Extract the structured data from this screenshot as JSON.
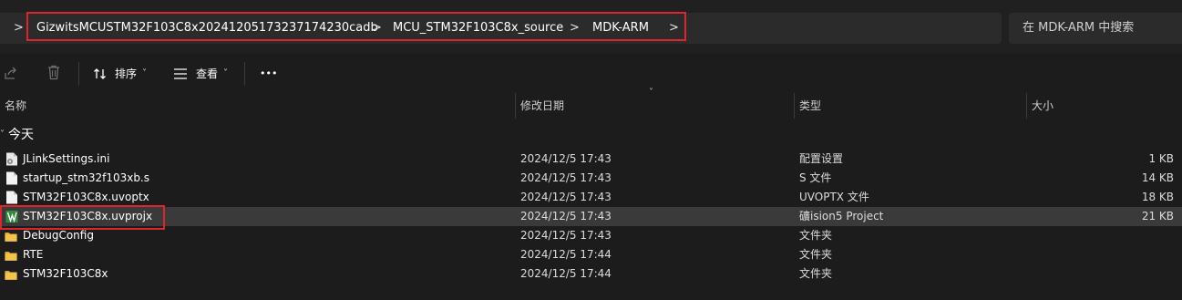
{
  "address_bar": {
    "crumbs": [
      "GizwitsMCUSTM32F103C8x20241205173237174230cadb",
      "MCU_STM32F103C8x_source",
      "MDK-ARM"
    ],
    "chevron": ">"
  },
  "search": {
    "placeholder": "在 MDK-ARM 中搜索"
  },
  "toolbar": {
    "sort_label": "排序",
    "view_label": "查看",
    "more_label": "•••",
    "dropdown_glyph": "˅",
    "icons": [
      "share-icon",
      "delete-icon",
      "sort-icon",
      "view-icon",
      "more-icon"
    ]
  },
  "columns": {
    "name": "名称",
    "modified": "修改日期",
    "type": "类型",
    "size": "大小",
    "sort_indicator": "˅"
  },
  "group": {
    "label": "今天",
    "chevron": "˅"
  },
  "files": [
    {
      "name": "JLinkSettings.ini",
      "modified": "2024/12/5 17:43",
      "type": "配置设置",
      "size": "1 KB",
      "icon": "ini-file-icon"
    },
    {
      "name": "startup_stm32f103xb.s",
      "modified": "2024/12/5 17:43",
      "type": "S 文件",
      "size": "14 KB",
      "icon": "file-icon"
    },
    {
      "name": "STM32F103C8x.uvoptx",
      "modified": "2024/12/5 17:43",
      "type": "UVOPTX 文件",
      "size": "18 KB",
      "icon": "file-icon"
    },
    {
      "name": "STM32F103C8x.uvprojx",
      "modified": "2024/12/5 17:43",
      "type": "礦ision5 Project",
      "size": "21 KB",
      "icon": "keil-project-icon",
      "selected": true
    },
    {
      "name": "DebugConfig",
      "modified": "2024/12/5 17:43",
      "type": "文件夹",
      "size": "",
      "icon": "folder-icon"
    },
    {
      "name": "RTE",
      "modified": "2024/12/5 17:44",
      "type": "文件夹",
      "size": "",
      "icon": "folder-icon"
    },
    {
      "name": "STM32F103C8x",
      "modified": "2024/12/5 17:44",
      "type": "文件夹",
      "size": "",
      "icon": "folder-icon"
    }
  ],
  "colors": {
    "background": "#1c1c1c",
    "selected_row": "#3a3a3a",
    "highlight_box": "#e0242e",
    "folder": "#f2c44c",
    "keil_icon": "#3aa04a"
  }
}
